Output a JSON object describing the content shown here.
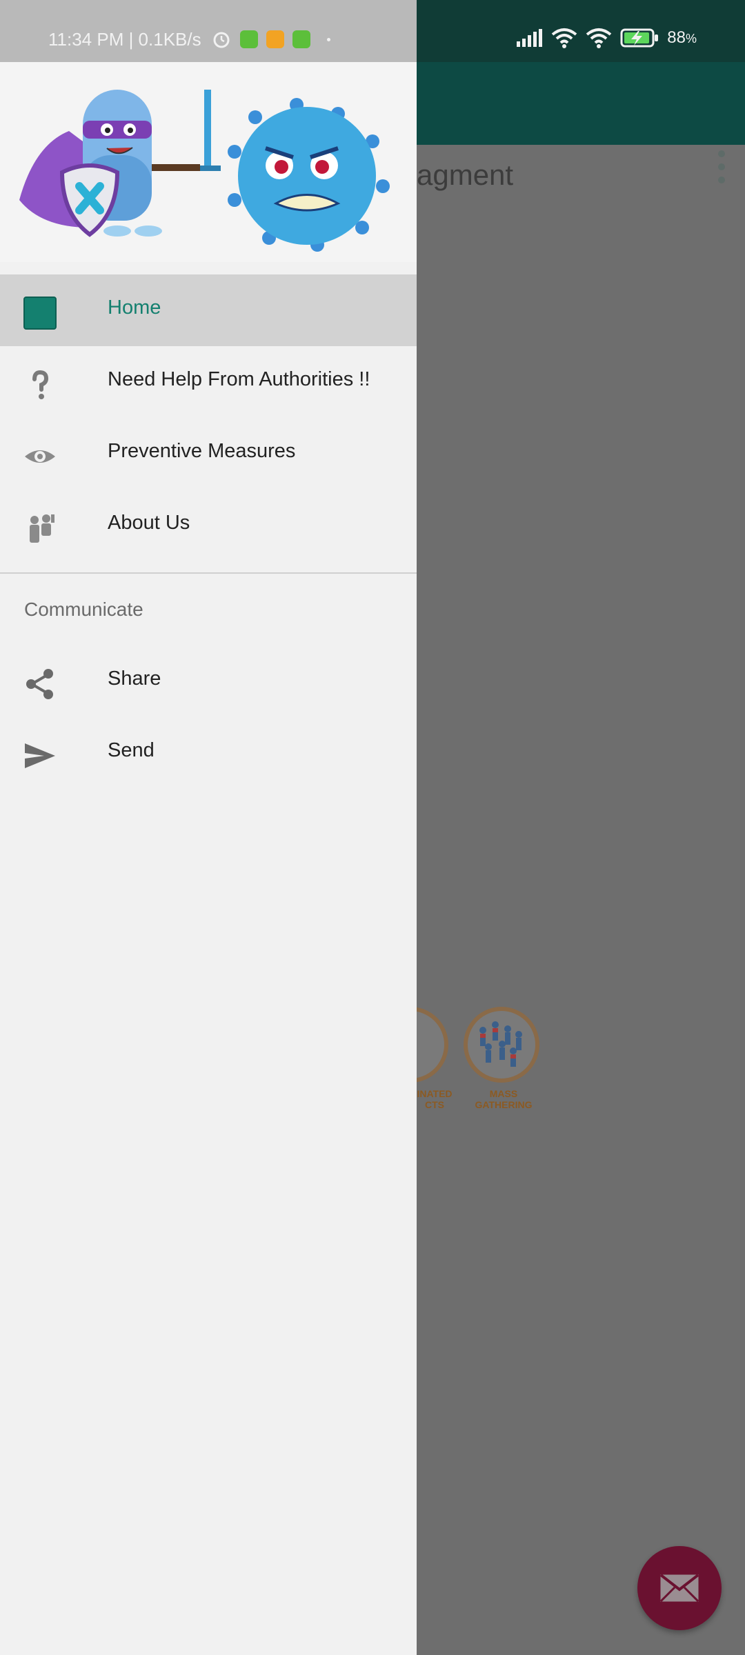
{
  "status_bar": {
    "time": "11:34 PM | 0.1KB/s",
    "battery": "88",
    "battery_unit": "%"
  },
  "background_app": {
    "fragment_text": "ragment",
    "category_labels": [
      "INATED\nCTS",
      "MASS\nGATHERING"
    ]
  },
  "drawer": {
    "items": [
      {
        "label": "Home",
        "icon": "home-square-icon",
        "active": true
      },
      {
        "label": "Need Help From Authorities !!",
        "icon": "question-icon",
        "active": false
      },
      {
        "label": "Preventive Measures",
        "icon": "eye-icon",
        "active": false
      },
      {
        "label": "About Us",
        "icon": "people-icon",
        "active": false
      }
    ],
    "section_title": "Communicate",
    "communicate_items": [
      {
        "label": "Share",
        "icon": "share-icon"
      },
      {
        "label": "Send",
        "icon": "send-icon"
      }
    ]
  },
  "colors": {
    "accent": "#14806f",
    "toolbar": "#0d4a44",
    "fab": "#6a1130"
  }
}
